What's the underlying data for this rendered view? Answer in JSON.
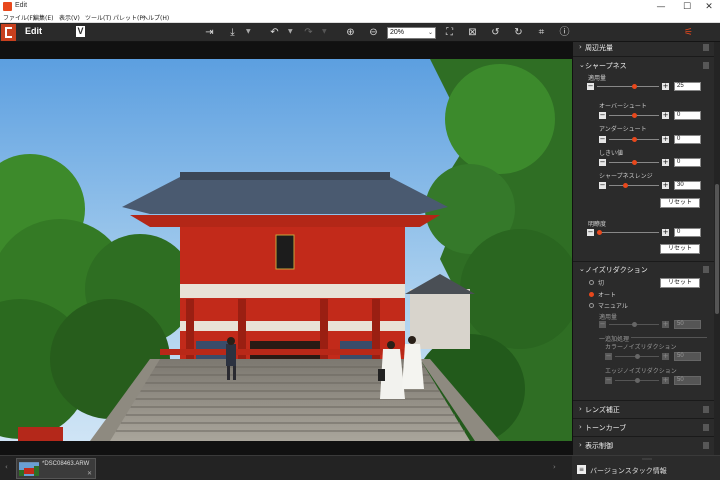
{
  "window": {
    "title": "Edit",
    "controls": {
      "minimize": "—",
      "maximize": "☐",
      "close": "✕"
    }
  },
  "menu": [
    "ファイル(F)",
    "編集(E)",
    "表示(V)",
    "ツール(T)",
    "パレット(P)",
    "ヘルプ(H)"
  ],
  "toolbar": {
    "mode_label": "Edit",
    "logo_letter": "V",
    "icons": [
      "export-icon",
      "download-icon",
      "undo-icon",
      "redo-icon",
      "zoom-in-icon",
      "zoom-out-icon",
      "fit-icon",
      "actual-size-icon",
      "rotate-left-icon",
      "rotate-right-icon",
      "crop-icon",
      "info-icon",
      "adjust-icon"
    ],
    "zoom_value": "20%"
  },
  "filmstrip": {
    "file_name": "*DSC08463.ARW"
  },
  "panel": {
    "sections": {
      "peripheral": "周辺光量",
      "sharpness": "シャープネス",
      "noise": "ノイズリダクション",
      "lens": "レンズ補正",
      "tone_curve": "トーンカーブ",
      "display": "表示制御"
    },
    "sharpness": {
      "amount_label": "適用量",
      "amount_value": "25",
      "overshoot_label": "オーバーシュート",
      "overshoot_value": "0",
      "undershoot_label": "アンダーシュート",
      "undershoot_value": "0",
      "threshold_label": "しきい値",
      "threshold_value": "0",
      "range_label": "シャープネスレンジ",
      "range_value": "30",
      "reset_label": "リセット",
      "clarity_label": "明瞭度",
      "clarity_value": "0",
      "reset2_label": "リセット"
    },
    "noise": {
      "opt_off": "切",
      "opt_auto": "オート",
      "opt_manual": "マニュアル",
      "reset_label": "リセット",
      "amount_label": "適用量",
      "amount_value": "50",
      "advanced_label": "一追加処理",
      "color_label": "カラーノイズリダクション",
      "color_value": "50",
      "edge_label": "エッジノイズリダクション",
      "edge_value": "50"
    },
    "footer_label": "バージョンスタック情報"
  },
  "colors": {
    "accent": "#e8481c",
    "panel_bg": "#2b2b2b",
    "toolbar_bg": "#2a2a2a"
  }
}
